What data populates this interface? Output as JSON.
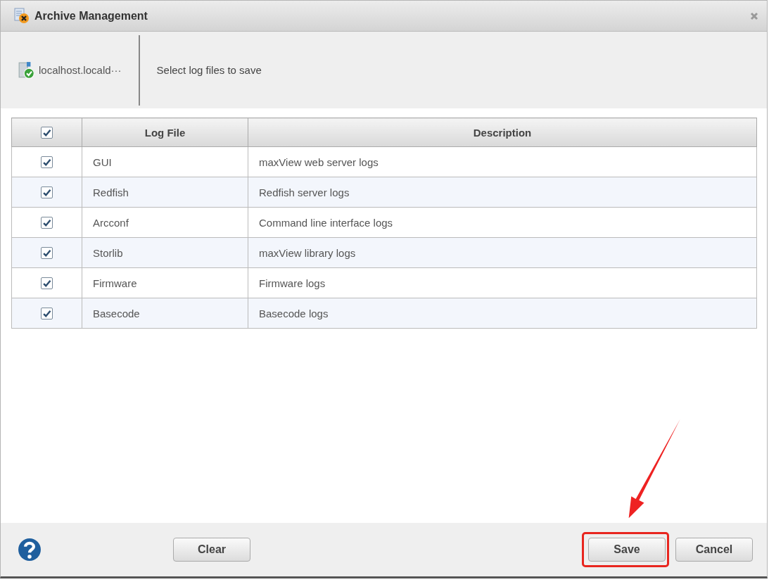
{
  "window": {
    "title": "Archive Management"
  },
  "header": {
    "host": "localhost.locald···",
    "instruction": "Select log files to save"
  },
  "table": {
    "all_checked": true,
    "columns": [
      "Log File",
      "Description"
    ],
    "rows": [
      {
        "checked": true,
        "file": "GUI",
        "description": "maxView web server logs"
      },
      {
        "checked": true,
        "file": "Redfish",
        "description": "Redfish server logs"
      },
      {
        "checked": true,
        "file": "Arcconf",
        "description": "Command line interface logs"
      },
      {
        "checked": true,
        "file": "Storlib",
        "description": "maxView library logs"
      },
      {
        "checked": true,
        "file": "Firmware",
        "description": "Firmware logs"
      },
      {
        "checked": true,
        "file": "Basecode",
        "description": "Basecode logs"
      }
    ]
  },
  "footer": {
    "buttons": [
      {
        "label": "Clear",
        "kind": "left"
      },
      {
        "label": "Save",
        "kind": "right"
      },
      {
        "label": "Cancel",
        "kind": "right"
      }
    ]
  }
}
